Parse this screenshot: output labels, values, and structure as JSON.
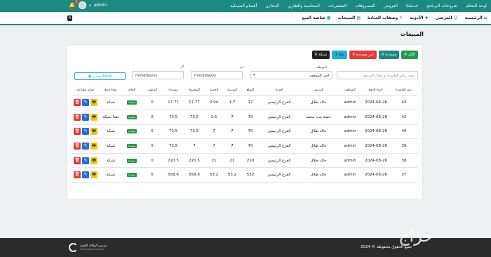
{
  "topnav": {
    "items": [
      "لوحة التحكم",
      "شروحات البرنامج",
      "خدماتنا",
      "العروض",
      "المصروفات",
      "المشتريات",
      "المحاسبة والتقارير",
      "المخازن",
      "أقسام الصيدلية"
    ],
    "user": "admin",
    "notifications": "1"
  },
  "subnav": {
    "items": [
      {
        "label": "الرئيسية",
        "icon": "home-icon",
        "glyph": "⌂"
      },
      {
        "label": "المرضى",
        "icon": "users-icon",
        "glyph": "☺"
      },
      {
        "label": "الأدوية",
        "icon": "pills-icon",
        "glyph": "✚"
      },
      {
        "label": "وصفات العيادة",
        "icon": "prescription-icon",
        "glyph": "✎"
      },
      {
        "label": "المبيعات",
        "icon": "sales-icon",
        "glyph": "▤"
      },
      {
        "label": "شاشة البيع",
        "icon": "cart-icon",
        "glyph": "▦"
      }
    ],
    "lang": "A"
  },
  "page": {
    "title": "المبيعات"
  },
  "filters": {
    "all": "الكل 6",
    "paid": "مسددة 6",
    "unpaid": "غير مسددة 0",
    "cash": "نقدا 1",
    "network": "شبكة 6"
  },
  "search": {
    "placeholder": "بحث برقم الفاتورة او جوال المريض"
  },
  "employee": {
    "label": "الموظف",
    "value": "اختر الموظف"
  },
  "dates": {
    "from_label": "من",
    "to_label": "الى",
    "placeholder": "mm/dd/yyyy"
  },
  "excel": {
    "label": "تصدير Excel"
  },
  "table": {
    "headers": [
      "رقم الفاتورة",
      "تاريخ الدفع",
      "الموظف",
      "المريض",
      "الفرع",
      "المبلغ",
      "الضريبة",
      "الخصم",
      "المجموع",
      "مسددة",
      "المتبقي",
      "الحالة",
      "نوع الدفع",
      "تحكم وطباعة"
    ],
    "rows": [
      {
        "id": "43",
        "date": "2024-08-26",
        "employee": "admin",
        "patient": "خالد طلال",
        "branch": "الفرع الرئيسي",
        "amount": "17",
        "tax": "1.7",
        "discount": "0.94",
        "total": "17.77",
        "paid": "17.77",
        "remaining": "0",
        "status": "مسددة",
        "pay": "شبكة"
      },
      {
        "id": "42",
        "date": "2024-08-26",
        "employee": "admin",
        "patient": "حصة بنت محمد",
        "branch": "الفرع الرئيسي",
        "amount": "70",
        "tax": "7",
        "discount": "3.5",
        "total": "73.5",
        "paid": "73.5",
        "remaining": "0",
        "status": "مسددة",
        "pay": "نقدا شبكة"
      },
      {
        "id": "40",
        "date": "2024-08-26",
        "employee": "admin",
        "patient": "خالد طلال",
        "branch": "الفرع الرئيسي",
        "amount": "70",
        "tax": "7",
        "discount": "7",
        "total": "73.5",
        "paid": "73.5",
        "remaining": "0",
        "status": "مسددة",
        "pay": "شبكة"
      },
      {
        "id": "39",
        "date": "2024-08-26",
        "employee": "admin",
        "patient": "خالد طلال",
        "branch": "الفرع الرئيسي",
        "amount": "70",
        "tax": "7",
        "discount": "7",
        "total": "7",
        "paid": "73.5",
        "remaining": "0",
        "status": "مسددة",
        "pay": "شبكة"
      },
      {
        "id": "38",
        "date": "2024-08-26",
        "employee": "admin",
        "patient": "خالد طلال",
        "branch": "الفرع الرئيسي",
        "amount": "210",
        "tax": "21",
        "discount": "21",
        "total": "220.5",
        "paid": "220.5",
        "remaining": "0",
        "status": "مسددة",
        "pay": "شبكة"
      },
      {
        "id": "37",
        "date": "2024-08-26",
        "employee": "admin",
        "patient": "خالد طلال",
        "branch": "الفرع الرئيسي",
        "amount": "532",
        "tax": "53.2",
        "discount": "53.2",
        "total": "558.6",
        "paid": "558.6",
        "remaining": "0",
        "status": "مسددة",
        "pay": "شبكة"
      }
    ]
  },
  "footer": {
    "copyright": "جميع الحقوق محفوظة © 2024",
    "brand": "تصميم الوكالة التقنية",
    "brand_sub": "TECH AGENCY DESIGN"
  },
  "watermark": "حراج"
}
